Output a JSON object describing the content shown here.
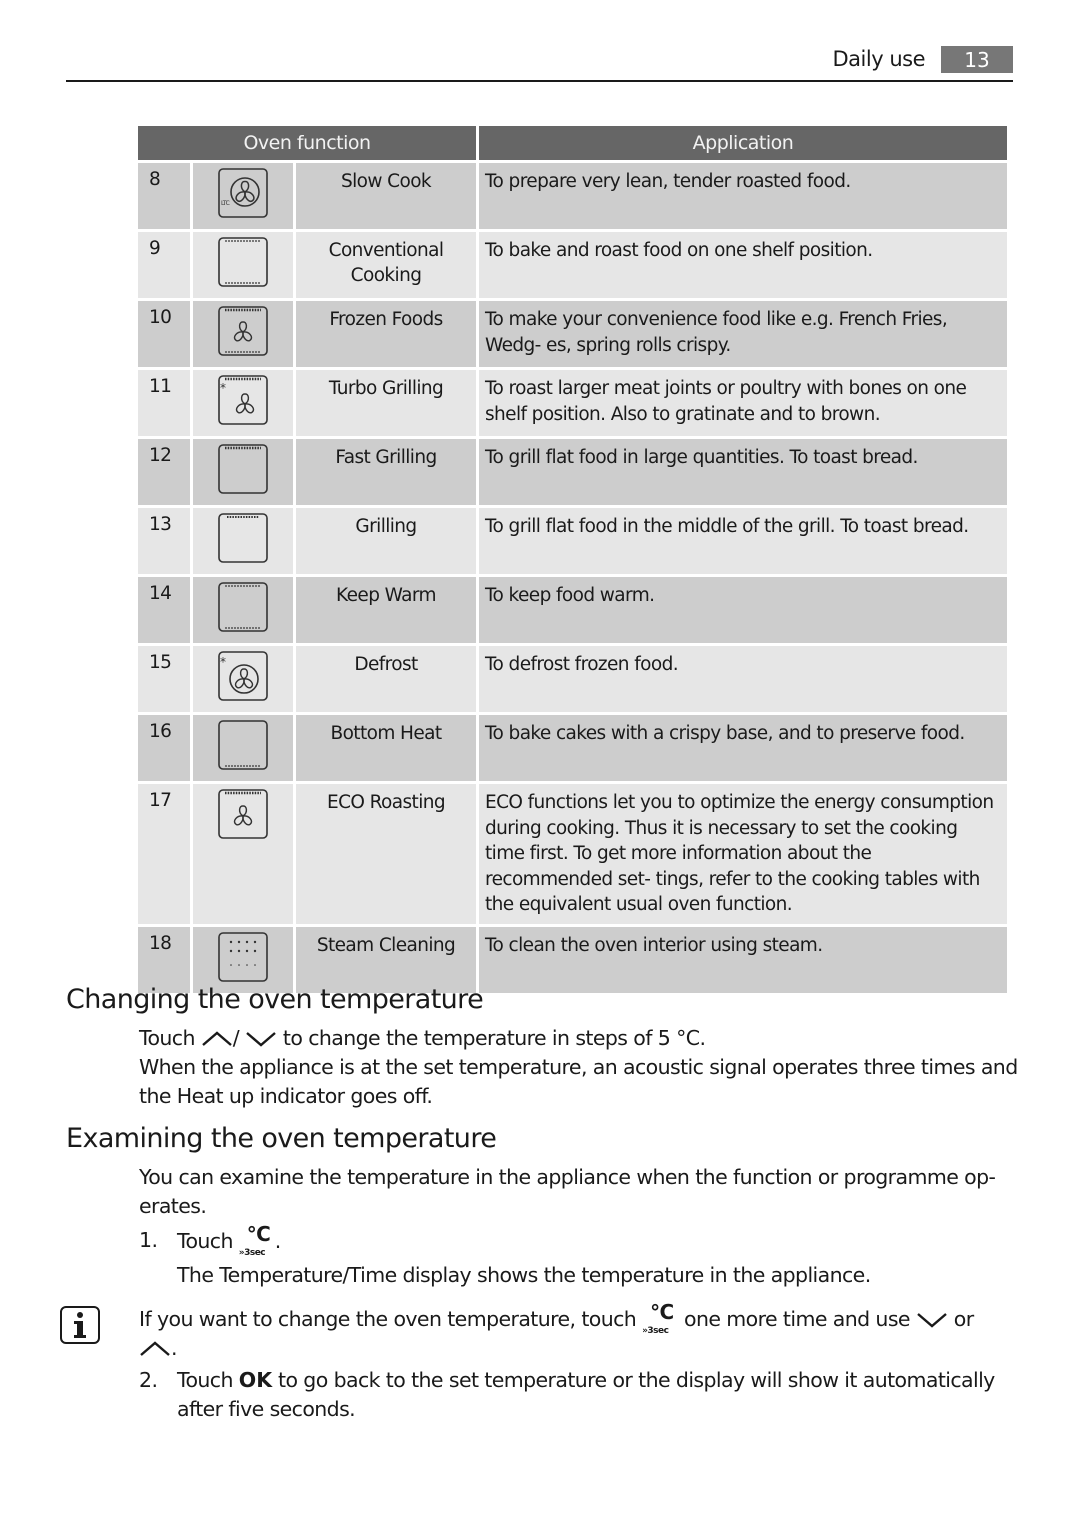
{
  "header": {
    "section": "Daily use",
    "page_number": "13"
  },
  "table": {
    "headers": {
      "function": "Oven function",
      "application": "Application"
    },
    "rows": [
      {
        "num": "8",
        "icon": "slow-cook-icon",
        "name": "Slow Cook",
        "application": "To prepare very lean, tender roasted food."
      },
      {
        "num": "9",
        "icon": "conventional-cooking-icon",
        "name": "Conventional Cooking",
        "application": "To bake and roast food on one shelf position."
      },
      {
        "num": "10",
        "icon": "frozen-foods-icon",
        "name": "Frozen Foods",
        "application": "To make your convenience food like e.g. French Fries, Wedg- es, spring rolls crispy."
      },
      {
        "num": "11",
        "icon": "turbo-grilling-icon",
        "name": "Turbo Grilling",
        "application": "To roast larger meat joints or poultry with bones on one shelf position. Also to gratinate and to brown."
      },
      {
        "num": "12",
        "icon": "fast-grilling-icon",
        "name": "Fast Grilling",
        "application": "To grill flat food in large quantities. To toast bread."
      },
      {
        "num": "13",
        "icon": "grilling-icon",
        "name": "Grilling",
        "application": "To grill flat food in the middle of the grill. To toast bread."
      },
      {
        "num": "14",
        "icon": "keep-warm-icon",
        "name": "Keep Warm",
        "application": "To keep food warm."
      },
      {
        "num": "15",
        "icon": "defrost-icon",
        "name": "Defrost",
        "application": "To defrost frozen food."
      },
      {
        "num": "16",
        "icon": "bottom-heat-icon",
        "name": "Bottom Heat",
        "application": "To bake cakes with a crispy base, and to preserve food."
      },
      {
        "num": "17",
        "icon": "eco-roasting-icon",
        "name": "ECO Roasting",
        "application": "ECO functions let you to optimize the energy consumption during cooking. Thus it is necessary to set the cooking time first. To get more information about the recommended set- tings, refer to the cooking tables with the equivalent usual oven function."
      },
      {
        "num": "18",
        "icon": "steam-cleaning-icon",
        "name": "Steam Cleaning",
        "application": "To clean the oven interior using steam."
      }
    ]
  },
  "changing": {
    "title": "Changing the oven temperature",
    "line1_pre": "Touch",
    "line1_sep": "/",
    "line1_post": "to change the temperature in steps of 5 °C.",
    "line2": "When the appliance is at the set temperature, an acoustic signal operates three times and the Heat up indicator goes off."
  },
  "examining": {
    "title": "Examining the oven temperature",
    "intro": "You can examine the temperature in the appliance when the function or programme op- erates.",
    "step1_num": "1.",
    "step1_pre": "Touch",
    "step1_post": ".",
    "step1_detail": "The Temperature/Time display shows the temperature in the appliance.",
    "info_pre": "If you want to change the oven temperature, touch",
    "info_mid": "one more time and use",
    "info_or": "or",
    "info_end": ".",
    "step2_num": "2.",
    "step2_pre": "Touch",
    "step2_ok": "OK",
    "step2_post": "to go back to the set temperature or the display will show it automatically after five seconds."
  },
  "button_glyphs": {
    "degree": "°C",
    "duration": "»3sec"
  }
}
